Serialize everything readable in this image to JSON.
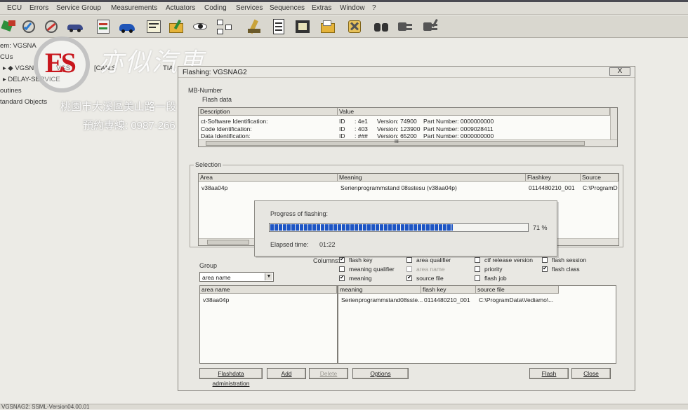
{
  "menu": [
    "ECU",
    "Errors",
    "Service Group",
    "Measurements",
    "Actuators",
    "Coding",
    "Services",
    "Sequences",
    "Extras",
    "Window",
    "?"
  ],
  "tree": [
    "em: VGSNA",
    "CUs",
    "VGSN",
    "VGS",
    "[CAN:S",
    "TIA",
    "DELAY-SERVICE",
    "outines",
    "tandard Objects"
  ],
  "watermark": {
    "logo": "ES",
    "brand": "亦似汽車",
    "address": "桃園市大溪區美山路一段",
    "phone": "預約專線: 0987-266"
  },
  "dialog": {
    "title": "Flashing: VGSNAG2",
    "close": "X",
    "mb_number_label": "MB-Number",
    "flash_data_label": "Flash data",
    "info_table": {
      "headers": [
        "Description",
        "Value"
      ],
      "rows": [
        [
          "ct-Software Identification:",
          "ID",
          ": 4e1",
          "Version: 74900",
          "Part Number: 0000000000"
        ],
        [
          "Code Identification:",
          "ID",
          ": 403",
          "Version: 123900",
          "Part Number: 0009028411"
        ],
        [
          "Data Identification:",
          "ID",
          ": ###",
          "Version: 65200",
          "Part Number: 0000000000"
        ]
      ],
      "scroll_thumb": "III"
    },
    "selection": {
      "label": "Selection",
      "headers": [
        "Area",
        "Meaning",
        "Flashkey",
        "Source"
      ],
      "row": [
        "v38aa04p",
        "Serienprogrammstand 08sstesu (v38aa04p)",
        "0114480210_001",
        "C:\\ProgramD"
      ]
    },
    "group": {
      "label": "Group",
      "value": "area name"
    },
    "columns_label": "Columns:",
    "checkboxes": [
      {
        "label": "flash key",
        "checked": true,
        "disabled": false
      },
      {
        "label": "area qualifier",
        "checked": false,
        "disabled": false
      },
      {
        "label": "ctf release version",
        "checked": false,
        "disabled": false
      },
      {
        "label": "flash session",
        "checked": false,
        "disabled": false
      },
      {
        "label": "meaning qualifier",
        "checked": false,
        "disabled": false
      },
      {
        "label": "area name",
        "checked": false,
        "disabled": true
      },
      {
        "label": "priority",
        "checked": false,
        "disabled": false
      },
      {
        "label": "flash class",
        "checked": true,
        "disabled": false
      },
      {
        "label": "meaning",
        "checked": true,
        "disabled": false
      },
      {
        "label": "source file",
        "checked": true,
        "disabled": false
      },
      {
        "label": "flash job",
        "checked": false,
        "disabled": false
      }
    ],
    "left_list": {
      "header": "area name",
      "item": "v38aa04p"
    },
    "right_list": {
      "headers": [
        "meaning",
        "flash key",
        "source file"
      ],
      "row": [
        "Serienprogrammstand08sste...",
        "0114480210_001",
        "C:\\ProgramData\\Vediamo\\..."
      ]
    },
    "buttons": {
      "flashdata_admin": "Flashdata administration",
      "add": "Add",
      "delete": "Delete",
      "options": "Options",
      "flash": "Flash",
      "close": "Close"
    }
  },
  "progress": {
    "label": "Progress of flashing:",
    "percent": 71,
    "percent_text": "71 %",
    "elapsed_label": "Elapsed time:",
    "elapsed_value": "01:22"
  },
  "status_bar": "VGSNAG2: SSML-Version04.00.01"
}
